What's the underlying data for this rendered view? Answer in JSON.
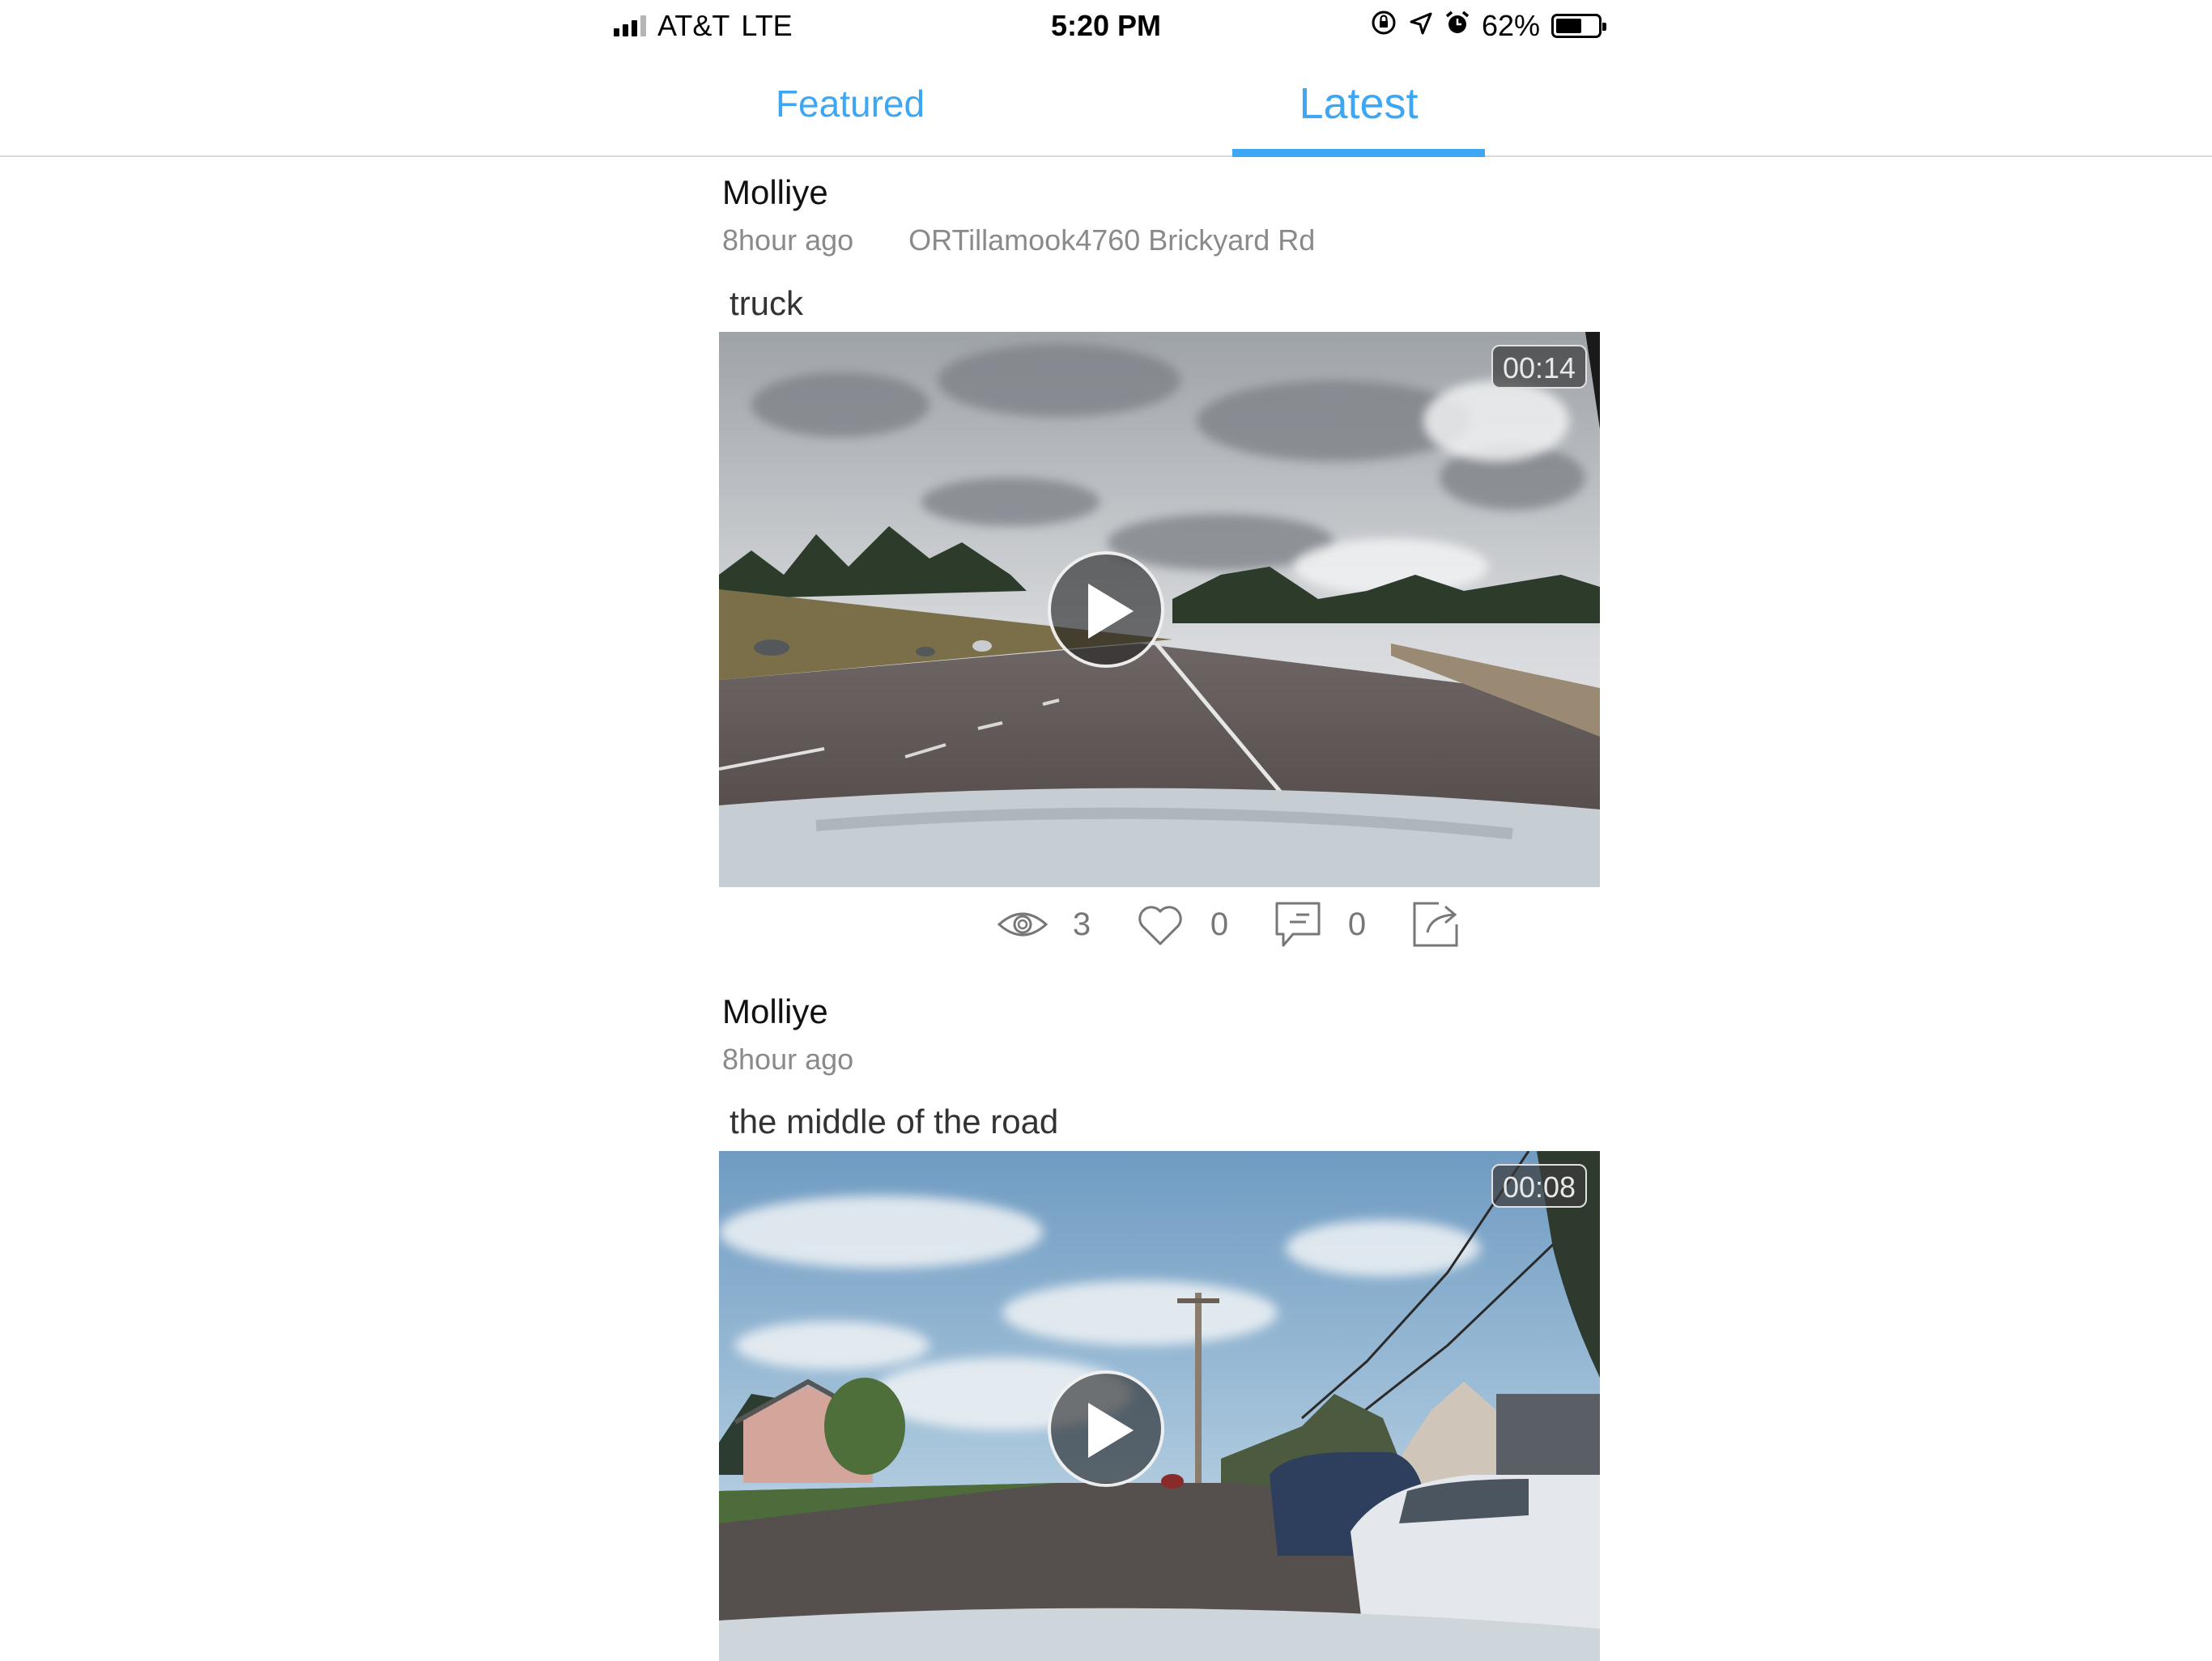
{
  "status_bar": {
    "carrier": "AT&T",
    "network": "LTE",
    "time": "5:20 PM",
    "battery_percent_label": "62%",
    "battery_level": 0.62
  },
  "tabs": [
    {
      "label": "Featured",
      "selected": false
    },
    {
      "label": "Latest",
      "selected": true
    }
  ],
  "colors": {
    "accent": "#3ea7f3",
    "text_muted": "#8a8a8a"
  },
  "posts": [
    {
      "author": "Molliye",
      "time_ago": "8hour ago",
      "location": "ORTillamook4760 Brickyard Rd",
      "caption": "o truck",
      "duration": "00:14",
      "views": "3",
      "likes": "0",
      "comments": "0"
    },
    {
      "author": "Molliye",
      "time_ago": "8hour ago",
      "caption": "n the middle of the road",
      "duration": "00:08"
    }
  ],
  "icons": [
    "signal-icon",
    "orientation-lock-icon",
    "location-arrow-icon",
    "alarm-icon",
    "battery-icon",
    "play-icon",
    "eye-icon",
    "heart-icon",
    "comment-icon",
    "share-icon"
  ]
}
